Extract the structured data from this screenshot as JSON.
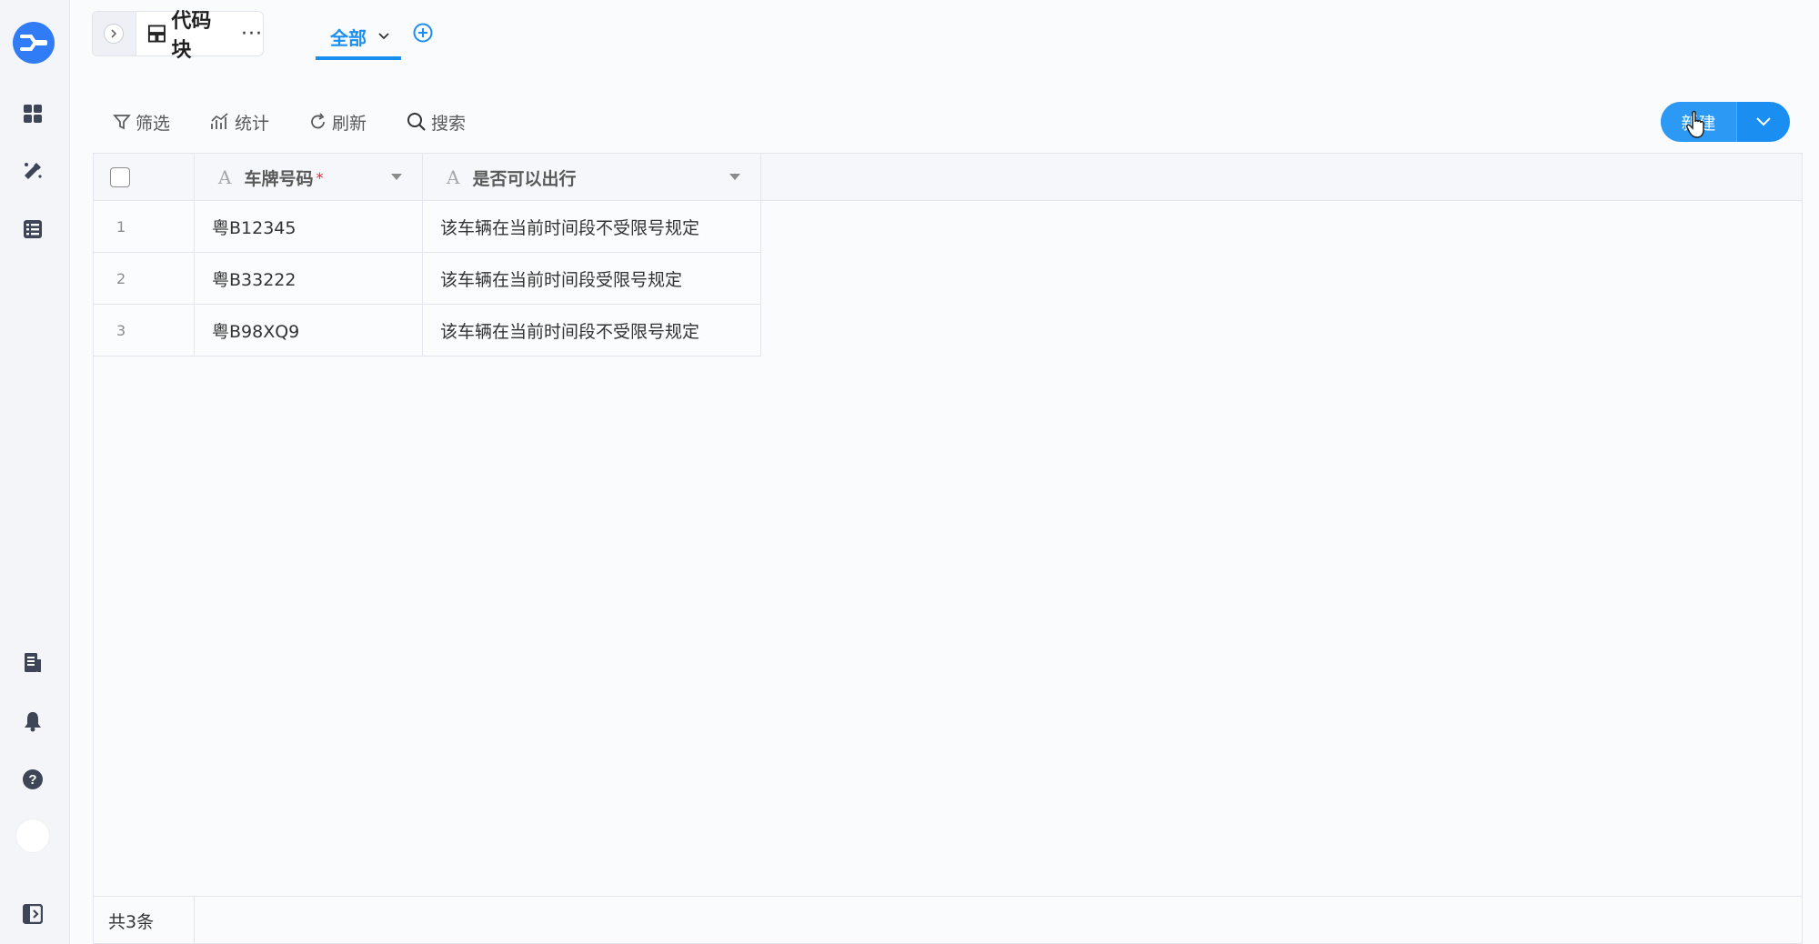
{
  "app": {
    "accent_color": "#1b8ff1"
  },
  "rail": {
    "icons": [
      "dashboard-icon",
      "magic-pen-icon",
      "list-icon",
      "document-icon",
      "bell-icon",
      "help-icon",
      "avatar",
      "collapse-sidebar-icon"
    ]
  },
  "header": {
    "doc_title": "代码块",
    "doc_type_icon": "table-icon",
    "more_icon": "more-icon",
    "view_tab_label": "全部",
    "add_view_icon": "plus-circle-icon"
  },
  "toolbar": {
    "filter_label": "筛选",
    "stats_label": "统计",
    "refresh_label": "刷新",
    "search_label": "搜索",
    "new_label": "新建"
  },
  "table": {
    "columns": [
      {
        "label": "车牌号码",
        "required": "*",
        "type_icon": "A"
      },
      {
        "label": "是否可以出行",
        "type_icon": "A"
      }
    ],
    "rows": [
      {
        "index": "1",
        "plate": "粤B12345",
        "status": "该车辆在当前时间段不受限号规定"
      },
      {
        "index": "2",
        "plate": "粤B33222",
        "status": "该车辆在当前时间段受限号规定"
      },
      {
        "index": "3",
        "plate": "粤B98XQ9",
        "status": "该车辆在当前时间段不受限号规定"
      }
    ],
    "footer_count": "共3条"
  }
}
